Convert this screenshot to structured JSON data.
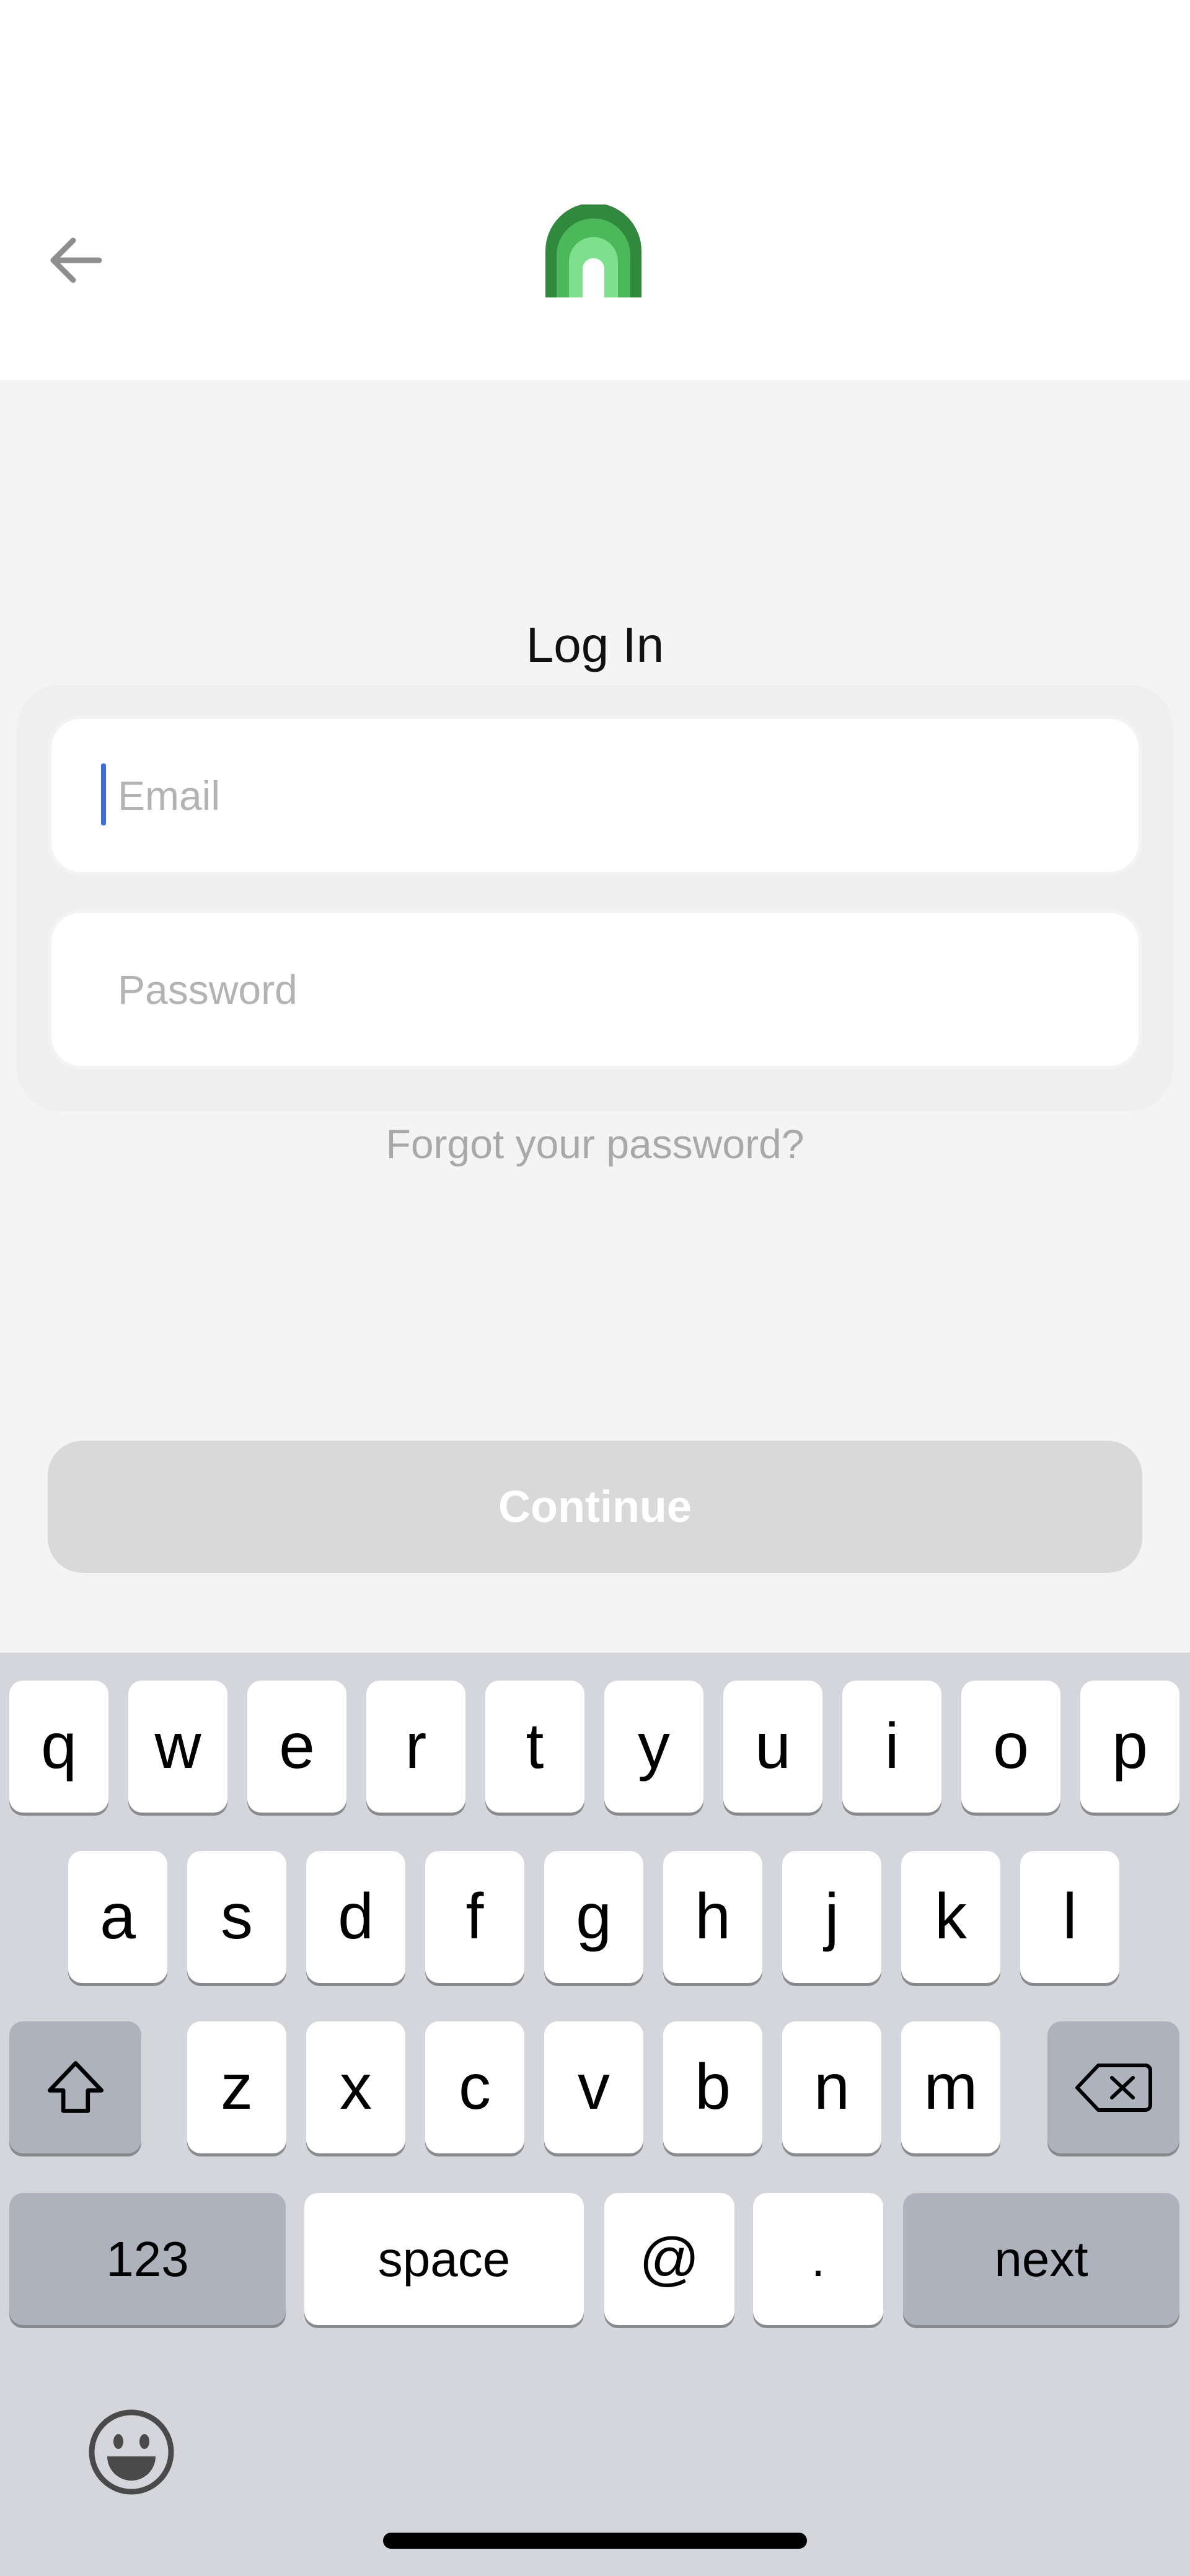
{
  "header": {
    "back_icon": "arrow-left-icon",
    "logo_icon": "arch-logo-icon"
  },
  "title": "Log In",
  "form": {
    "email_placeholder": "Email",
    "email_value": "",
    "password_placeholder": "Password",
    "password_value": ""
  },
  "forgot_label": "Forgot your password?",
  "continue_label": "Continue",
  "colors": {
    "accent_caret": "#3f6be0",
    "logo_dark": "#2f8a3e",
    "logo_mid": "#4bb85a",
    "logo_light": "#7ee08c",
    "button_disabled": "#d9d9d9"
  },
  "keyboard": {
    "row1": [
      "q",
      "w",
      "e",
      "r",
      "t",
      "y",
      "u",
      "i",
      "o",
      "p"
    ],
    "row2": [
      "a",
      "s",
      "d",
      "f",
      "g",
      "h",
      "j",
      "k",
      "l"
    ],
    "row3": [
      "z",
      "x",
      "c",
      "v",
      "b",
      "n",
      "m"
    ],
    "numbers_label": "123",
    "space_label": "space",
    "at_label": "@",
    "dot_label": ".",
    "next_label": "next",
    "shift_icon": "shift-icon",
    "delete_icon": "backspace-icon",
    "emoji_icon": "emoji-icon"
  }
}
